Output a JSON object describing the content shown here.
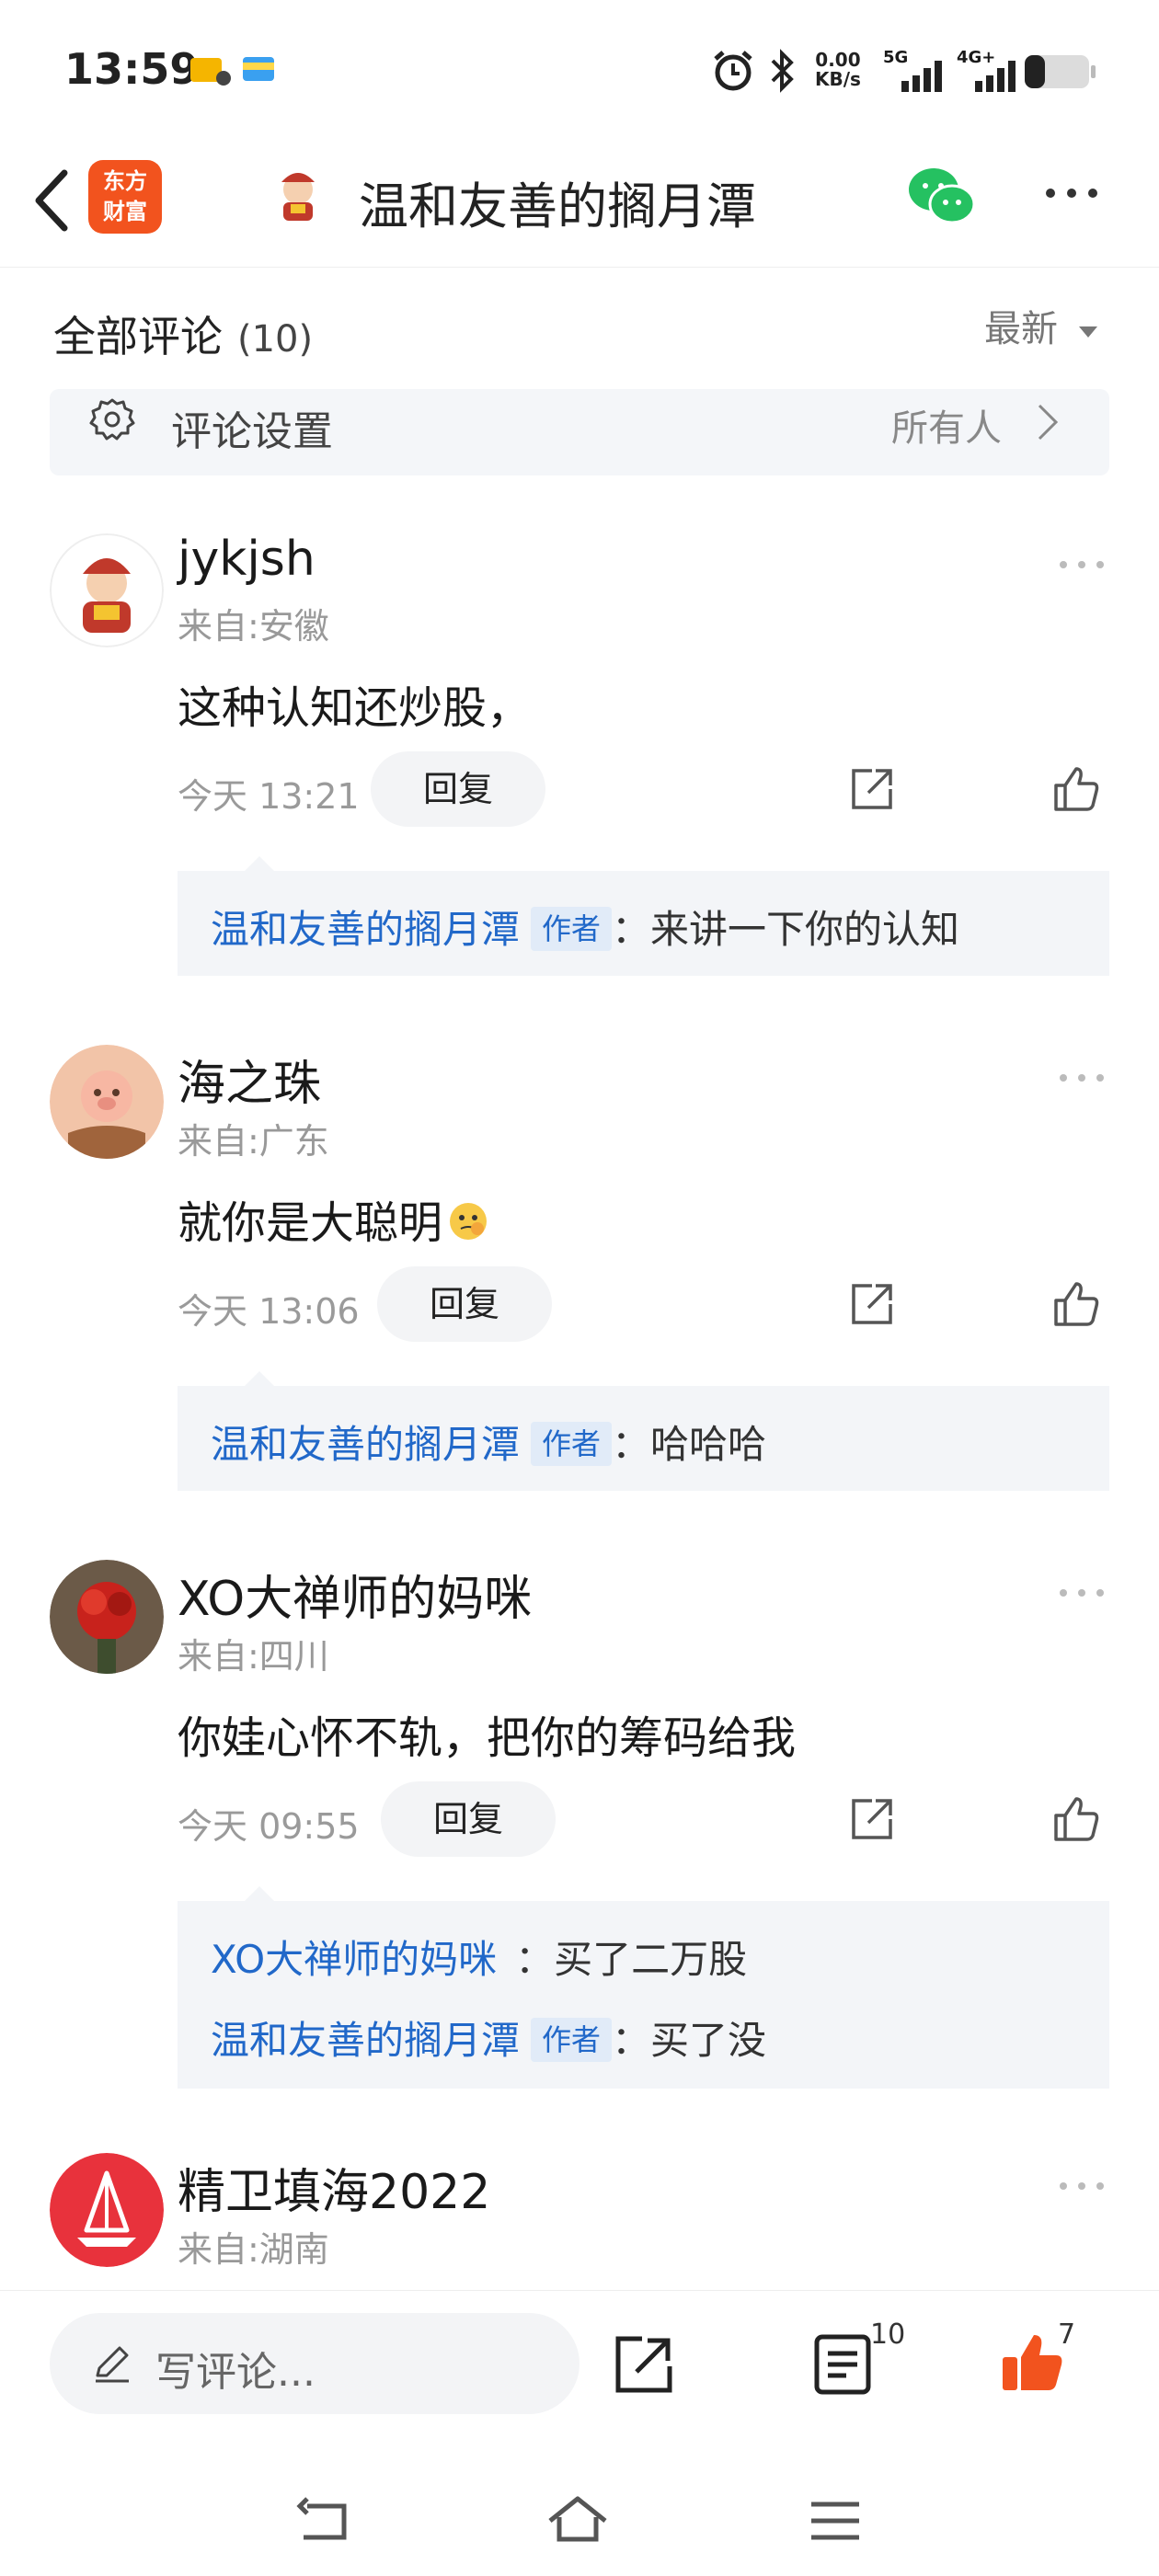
{
  "status_bar": {
    "time": "13:59",
    "net_speed_value": "0.00",
    "net_speed_unit": "KB/s",
    "sig1": "5G",
    "sig2": "4G+"
  },
  "nav": {
    "logo_line1": "东方",
    "logo_line2": "财富",
    "title": "温和友善的搁月潭",
    "icons": [
      "back-icon",
      "wechat-icon",
      "more-icon"
    ]
  },
  "comments_header": {
    "title": "全部评论",
    "count": "(10)",
    "sort_label": "最新"
  },
  "settings": {
    "label": "评论设置",
    "value": "所有人"
  },
  "comments": [
    {
      "user": "jykjsh",
      "location": "来自:安徽",
      "text": "这种认知还炒股，",
      "time": "今天 13:21",
      "reply_label": "回复",
      "replies": [
        {
          "name": "温和友善的搁月潭",
          "tag": "作者",
          "text": "：来讲一下你的认知"
        }
      ]
    },
    {
      "user": "海之珠",
      "location": "来自:广东",
      "text": "就你是大聪明",
      "time": "今天 13:06",
      "reply_label": "回复",
      "replies": [
        {
          "name": "温和友善的搁月潭",
          "tag": "作者",
          "text": "：哈哈哈"
        }
      ]
    },
    {
      "user": "XO大禅师的妈咪",
      "location": "来自:四川",
      "text": "你娃心怀不轨，把你的筹码给我",
      "time": "今天 09:55",
      "reply_label": "回复",
      "replies": [
        {
          "name": "XO大禅师的妈咪",
          "tag": "",
          "text": "：买了二万股"
        },
        {
          "name": "温和友善的搁月潭",
          "tag": "作者",
          "text": "：买了没"
        }
      ]
    },
    {
      "user": "精卫填海2022",
      "location": "来自:湖南",
      "text": "",
      "time": "",
      "reply_label": "",
      "replies": []
    }
  ],
  "bottom_bar": {
    "write_placeholder": "写评论...",
    "comment_count": "10",
    "like_count": "7"
  },
  "colors": {
    "accent_blue": "#2168c9",
    "like_orange": "#f2531e",
    "logo_bg": "#f2531e"
  }
}
